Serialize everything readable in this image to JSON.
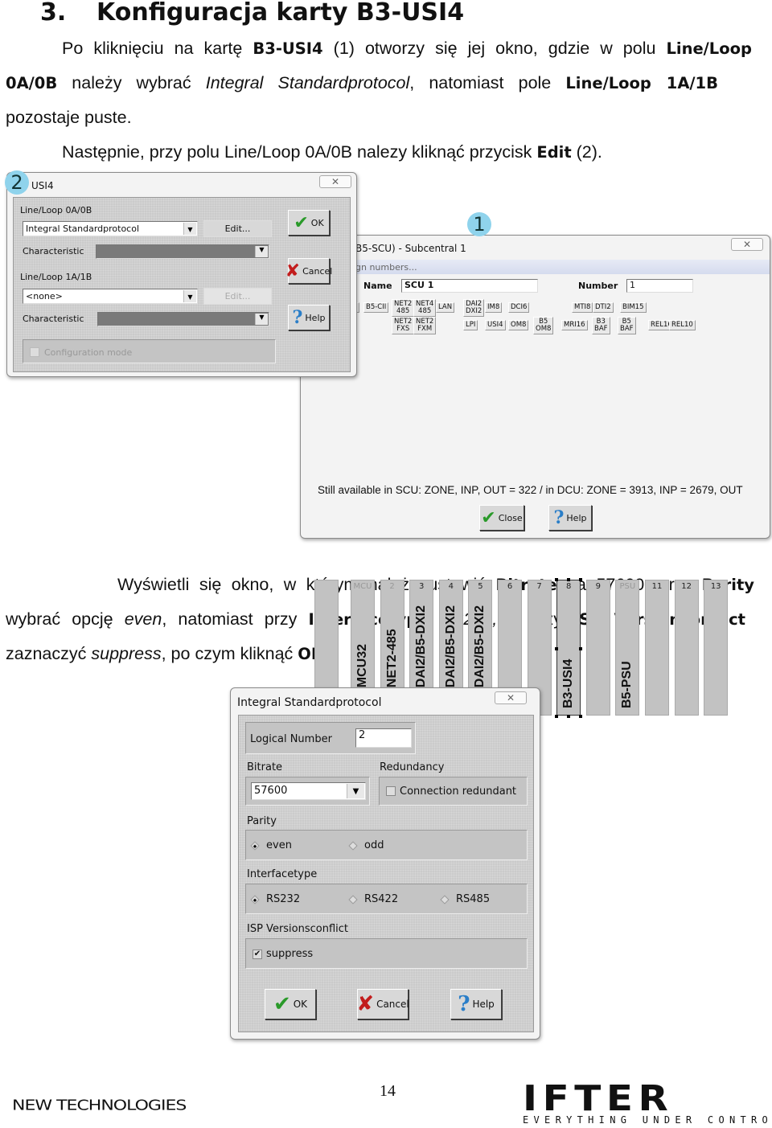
{
  "heading": {
    "number": "3.",
    "title": "Konfiguracja karty B3-USI4"
  },
  "paragraph1": [
    [
      {
        "t": "Po kliknięciu na kartę "
      },
      {
        "t": "B3-USI4",
        "s": "b"
      },
      {
        "t": " (1) otworzy się jej okno, gdzie w polu "
      },
      {
        "t": "Line/Loop",
        "s": "b"
      }
    ],
    [
      {
        "t": "0A/0B",
        "s": "b"
      },
      {
        "t": " należy wybrać "
      },
      {
        "t": "Integral Standardprotocol",
        "s": "i"
      },
      {
        "t": ", natomiast pole "
      },
      {
        "t": "Line/Loop 1A/1B",
        "s": "b"
      }
    ],
    [
      {
        "t": "pozostaje puste."
      }
    ],
    [
      {
        "t": "Następnie, przy polu Line/Loop 0A/0B nalezy kliknąć przycisk "
      },
      {
        "t": "Edit",
        "s": "b"
      },
      {
        "t": " (2)."
      }
    ]
  ],
  "paragraph2": [
    [
      {
        "t": "Wyświetli się okno, w którym należy ustawić "
      },
      {
        "t": "Bitrate",
        "s": "b"
      },
      {
        "t": " na 57600, przy "
      },
      {
        "t": "Parity",
        "s": "b"
      }
    ],
    [
      {
        "t": "wybrać opcję "
      },
      {
        "t": "even",
        "s": "i"
      },
      {
        "t": ", natomiast przy "
      },
      {
        "t": "Interfacetype",
        "s": "b"
      },
      {
        "t": " "
      },
      {
        "t": "RS232,",
        "s": "i"
      },
      {
        "t": " a przy "
      },
      {
        "t": "ISP Versionconflict",
        "s": "b"
      }
    ],
    [
      {
        "t": "zaznaczyć "
      },
      {
        "t": "suppress",
        "s": "i"
      },
      {
        "t": ", po czym kliknąć "
      },
      {
        "t": "OK",
        "s": "b"
      },
      {
        "t": "."
      }
    ]
  ],
  "badges": {
    "one": "1",
    "two": "2"
  },
  "usi4_dialog": {
    "title": "USI4",
    "close": "✕",
    "loop0_label": "Line/Loop 0A/0B",
    "loop0_value": "Integral Standardprotocol",
    "edit_label": "Edit...",
    "characteristic_label": "Characteristic",
    "loop1_label": "Line/Loop 1A/1B",
    "loop1_value": "<none>",
    "config_mode_label": "Configuration mode",
    "ok": "OK",
    "cancel": "Cancel",
    "help": "Help"
  },
  "scu_dialog": {
    "title": "B5-SCU) - Subcentral 1",
    "assign": "gn numbers...",
    "name_label": "Name",
    "name_value": "SCU 1",
    "number_label": "Number",
    "number_value": "1",
    "modules_row1": [
      "II",
      "B5-CII",
      "NET2\n485",
      "NET4\n485",
      "LAN",
      "DAI2\nDXI2",
      "IM8",
      "DCI6",
      "MTI8",
      "DTI2",
      "BIM15"
    ],
    "modules_row2": [
      "NET2\nFXS",
      "NET2\nFXM",
      "LPI",
      "USI4",
      "OM8",
      "B5\nOM8",
      "MRI16",
      "B3\nBAF",
      "B5\nBAF",
      "REL16",
      "REL10"
    ],
    "slots": [
      {
        "n": "",
        "m": ""
      },
      {
        "n": "MCU",
        "m": "B5-MCU32",
        "dim": true
      },
      {
        "n": "2",
        "m": "B5-NET2-485",
        "dim": true
      },
      {
        "n": "3",
        "m": "B3-DAI2/B5-DXI2"
      },
      {
        "n": "4",
        "m": "B3-DAI2/B5-DXI2"
      },
      {
        "n": "5",
        "m": "B3-DAI2/B5-DXI2"
      },
      {
        "n": "6",
        "m": ""
      },
      {
        "n": "7",
        "m": ""
      },
      {
        "n": "8",
        "m": "B3-USI4",
        "selected": true
      },
      {
        "n": "9",
        "m": ""
      },
      {
        "n": "PSU",
        "m": "B5-PSU",
        "dim": true
      },
      {
        "n": "11",
        "m": ""
      },
      {
        "n": "12",
        "m": ""
      },
      {
        "n": "13",
        "m": ""
      }
    ],
    "status": "Still available in SCU: ZONE, INP, OUT = 322 / in DCU: ZONE = 3913, INP = 2679, OUT",
    "close_btn": "Close",
    "help": "Help"
  },
  "protocol_dialog": {
    "title": "Integral Standardprotocol",
    "close": "✕",
    "logical_number_label": "Logical Number",
    "logical_number_value": "2",
    "bitrate_label": "Bitrate",
    "bitrate_value": "57600",
    "redundancy_label": "Redundancy",
    "connection_redundant": "Connection redundant",
    "connection_redundant_checked": false,
    "parity_label": "Parity",
    "parity_options": [
      "even",
      "odd"
    ],
    "parity_selected": "even",
    "interface_label": "Interfacetype",
    "interface_options": [
      "RS232",
      "RS422",
      "RS485"
    ],
    "interface_selected": "RS232",
    "isp_label": "ISP Versionsconflict",
    "suppress": "suppress",
    "suppress_checked": true,
    "ok": "OK",
    "cancel": "Cancel",
    "help": "Help"
  },
  "footer": {
    "page_number": "14",
    "left_logo": "NEW TECHNOLOGIES",
    "right_logo": "IFTER",
    "right_tagline": "EVERYTHING UNDER CONTROL"
  }
}
